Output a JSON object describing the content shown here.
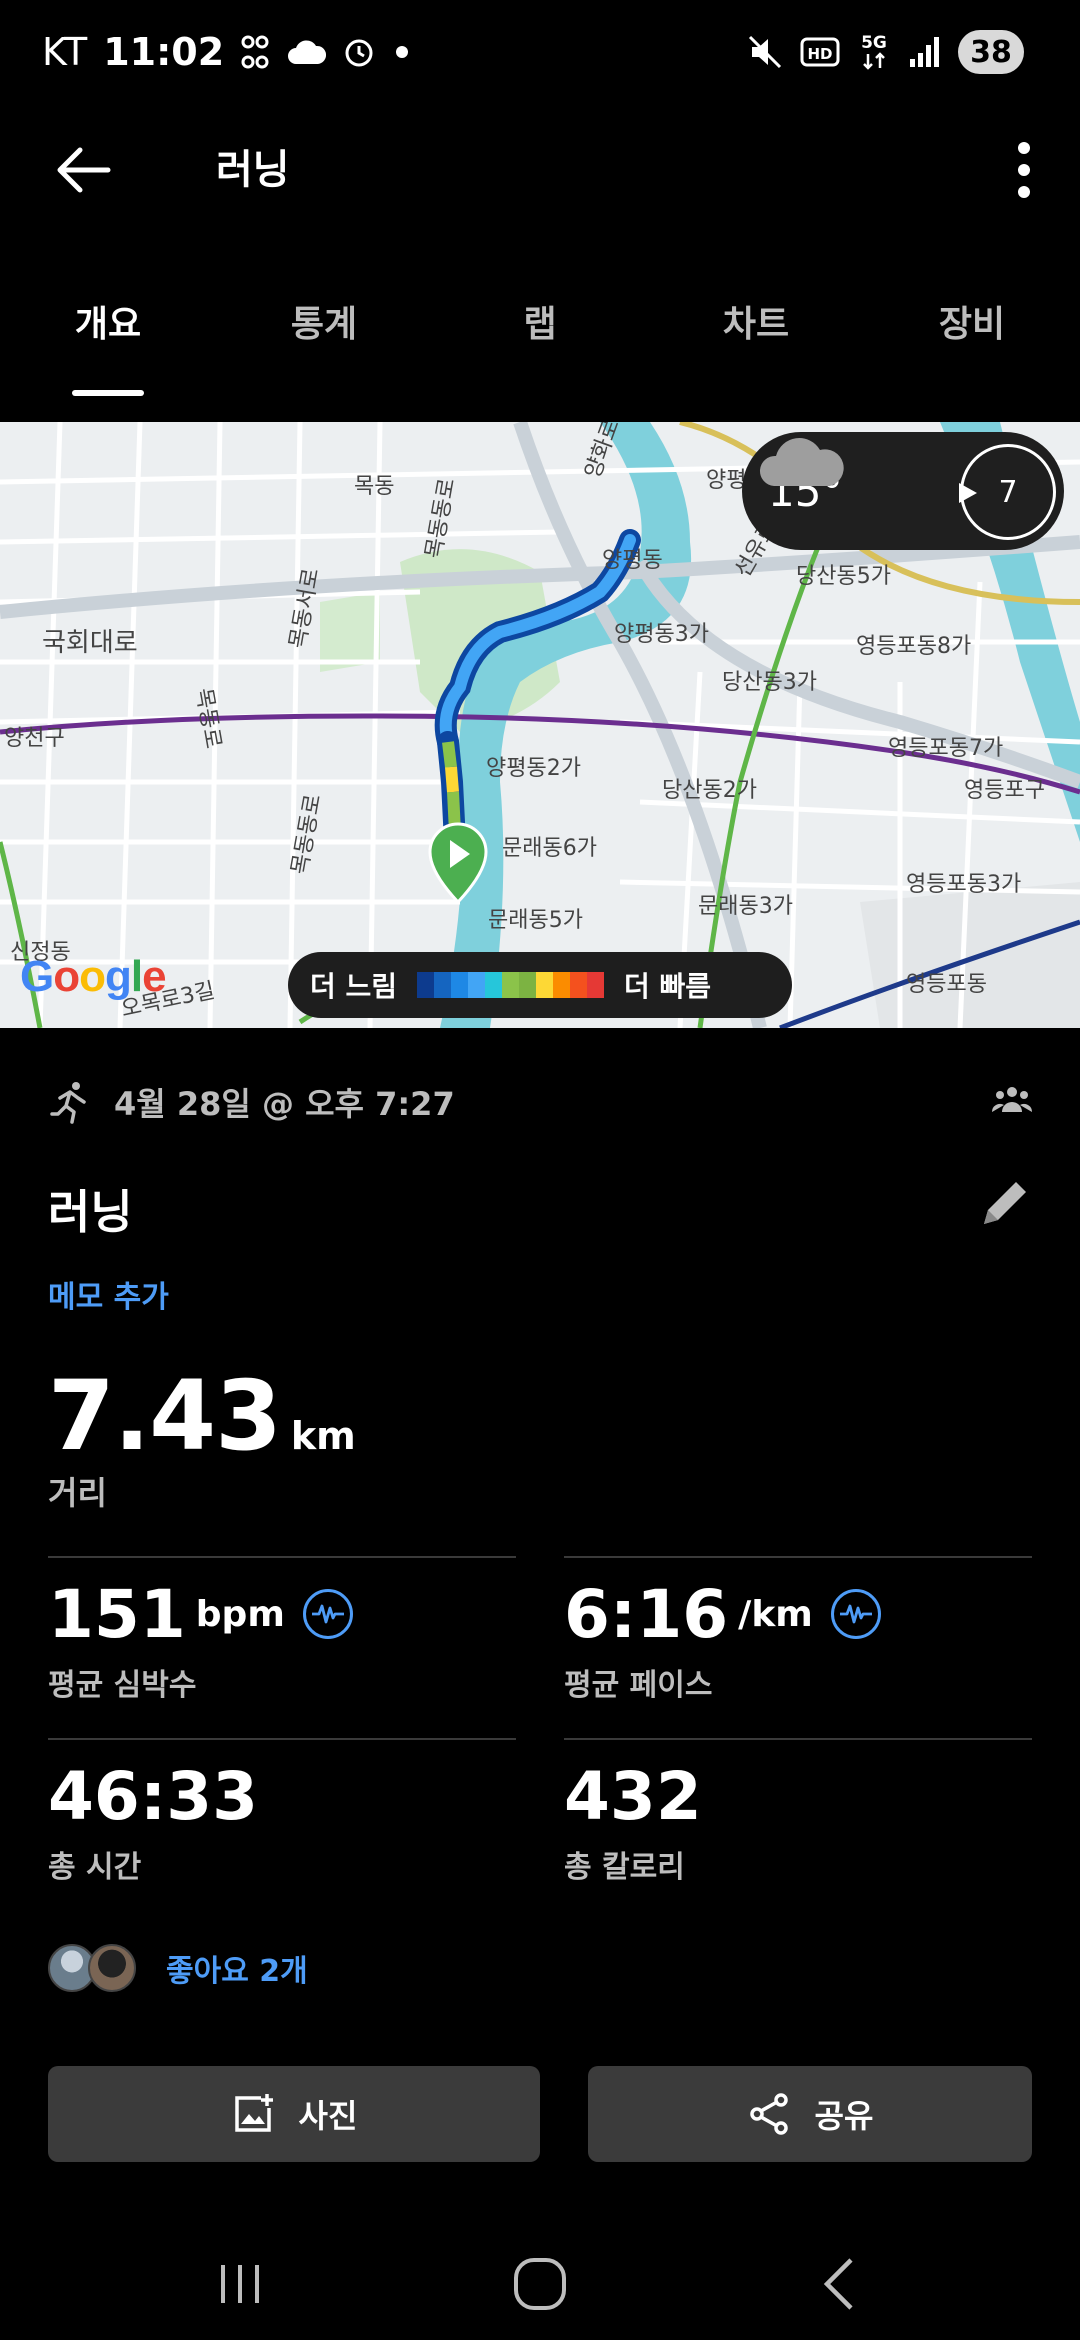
{
  "status_bar": {
    "carrier": "KT",
    "time": "11:02",
    "battery": "38"
  },
  "app_bar": {
    "title": "러닝"
  },
  "tabs": [
    {
      "label": "개요",
      "active": true
    },
    {
      "label": "통계",
      "active": false
    },
    {
      "label": "랩",
      "active": false
    },
    {
      "label": "차트",
      "active": false
    },
    {
      "label": "장비",
      "active": false
    }
  ],
  "map": {
    "weather": {
      "temp": "15°",
      "icon": "cloud-icon",
      "wind": "7"
    },
    "legend": {
      "slow": "더 느림",
      "fast": "더 빠름",
      "colors": [
        "#0d3b8e",
        "#1565c0",
        "#1e88e5",
        "#42a5f5",
        "#26c6da",
        "#8bc34a",
        "#7cb342",
        "#fdd835",
        "#fb8c00",
        "#f4511e",
        "#e53935"
      ]
    },
    "labels": {
      "l1": "목동",
      "l2": "양평",
      "l3": "양평동",
      "l4": "국회대로",
      "l5": "양평동3가",
      "l6": "당산동5가",
      "l7": "영등포동8가",
      "l8": "당산동3가",
      "l9": "영등포동7가",
      "l10": "양천구",
      "l11": "양평동2가",
      "l12": "당산동2가",
      "l13": "영등포구",
      "l14": "문래동6가",
      "l15": "영등포동3가",
      "l16": "문래동5가",
      "l17": "문래동3가",
      "l18": "영등포동",
      "l19": "신정동",
      "l20": "목동로",
      "l21": "목동서로",
      "l22": "목동동로",
      "l23": "목동동로",
      "l24": "오목로3길",
      "l25": "선유로",
      "l26": "양화로",
      "l27": "오목로3길"
    },
    "google": "Google"
  },
  "activity": {
    "date": "4월 28일 @ 오후 7:27",
    "title": "러닝",
    "memo_link": "메모 추가",
    "distance": {
      "value": "7.43",
      "unit": "km",
      "label": "거리"
    },
    "stats": {
      "heart_rate": {
        "value": "151",
        "unit": "bpm",
        "label": "평균 심박수"
      },
      "pace": {
        "value": "6:16",
        "unit": "/km",
        "label": "평균 페이스"
      },
      "time": {
        "value": "46:33",
        "label": "총 시간"
      },
      "calories": {
        "value": "432",
        "label": "총 칼로리"
      }
    },
    "likes": "좋아요 2개"
  },
  "buttons": {
    "photo": "사진",
    "share": "공유"
  }
}
